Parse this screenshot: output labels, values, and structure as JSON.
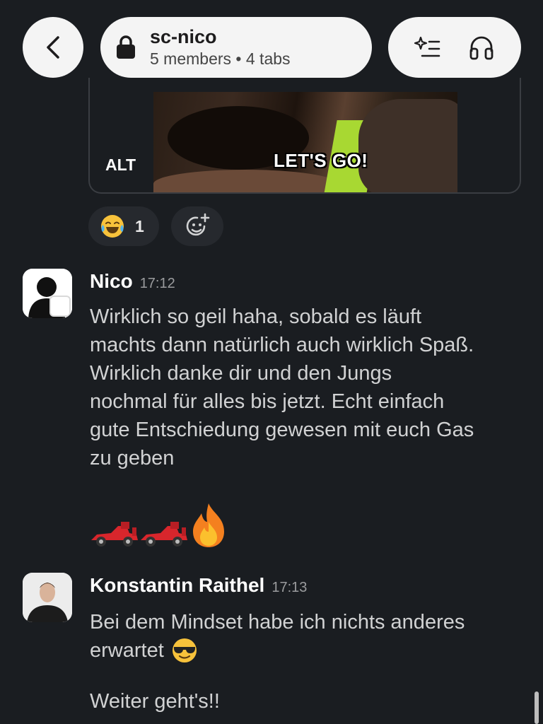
{
  "header": {
    "channel_name": "sc-nico",
    "channel_meta": "5 members • 4 tabs",
    "back_icon": "chevron-left-icon",
    "lock_icon": "lock-icon",
    "ai_summary_icon": "sparkle-list-icon",
    "huddle_icon": "headphones-icon"
  },
  "gif": {
    "caption": "LET'S GO!",
    "alt_label": "ALT"
  },
  "reactions": [
    {
      "emoji": "joy-emoji",
      "count": "1"
    }
  ],
  "messages": [
    {
      "author": "Nico",
      "time": "17:12",
      "lines": [
        "Wirklich so geil haha, sobald es läuft",
        "machts dann natürlich auch wirklich Spaß.",
        "Wirklich danke dir und den Jungs",
        "nochmal für alles bis jetzt. Echt einfach",
        "gute Entschiedung gewesen mit euch Gas",
        "zu geben"
      ],
      "emojis": [
        "racing-car-emoji",
        "racing-car-emoji",
        "fire-emoji"
      ]
    },
    {
      "author": "Konstantin Raithel",
      "time": "17:13",
      "lines": [
        "Bei dem Mindset habe ich nichts anderes",
        "erwartet"
      ],
      "inline_emoji": "sunglasses-emoji",
      "followup": "Weiter geht's!!"
    }
  ],
  "colors": {
    "background": "#1a1d21",
    "pill": "#f4f4f4",
    "reaction_bg": "#26292e",
    "text": "#d1d2d3",
    "author": "#ffffff",
    "timestamp": "#9b9c9e"
  }
}
